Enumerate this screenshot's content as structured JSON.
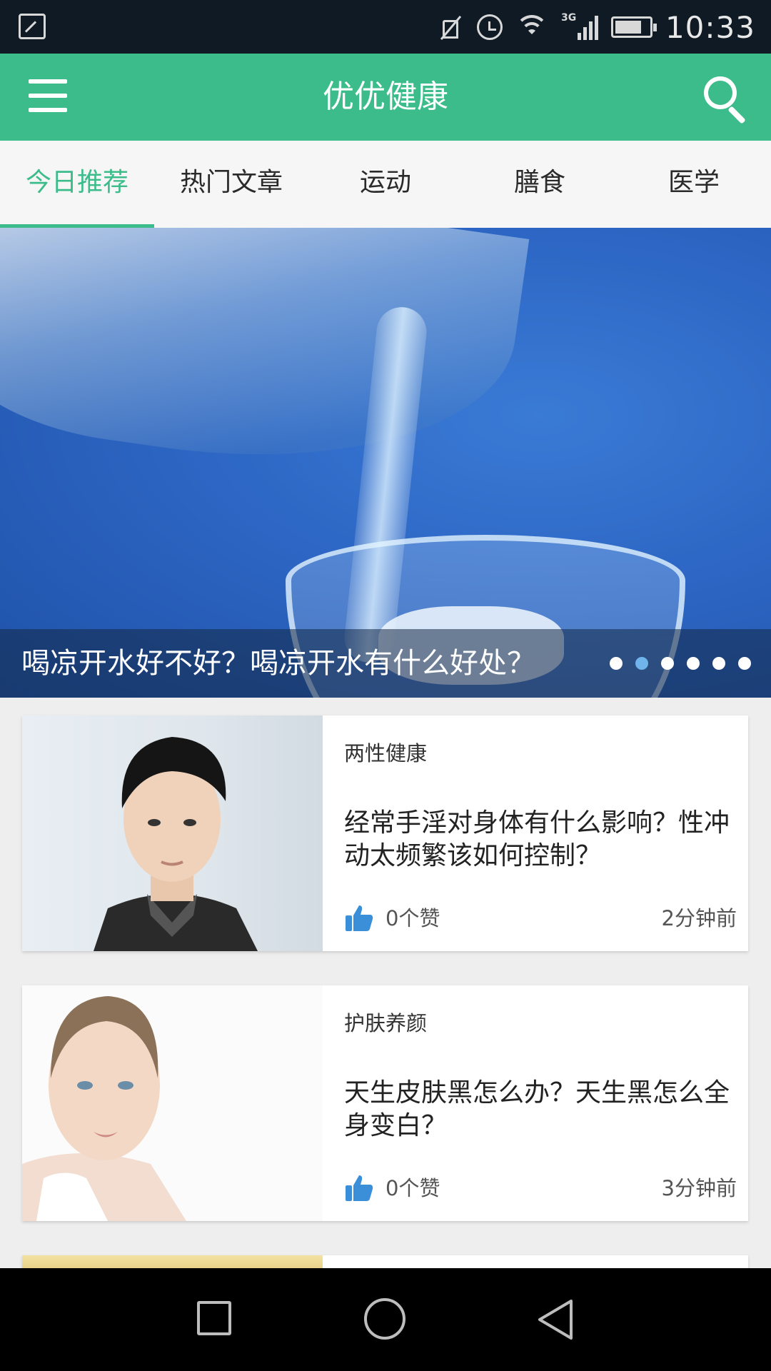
{
  "status_bar": {
    "time": "10:33",
    "network": "3G",
    "icons": [
      "gallery-icon",
      "mute-icon",
      "alarm-icon",
      "wifi-icon",
      "signal-icon",
      "battery-icon"
    ]
  },
  "app_bar": {
    "title": "优优健康",
    "menu_icon": "hamburger-menu-icon",
    "search_icon": "search-icon",
    "background_color": "#3cbc8a"
  },
  "tabs": [
    {
      "label": "今日推荐",
      "active": true
    },
    {
      "label": "热门文章",
      "active": false
    },
    {
      "label": "运动",
      "active": false
    },
    {
      "label": "膳食",
      "active": false
    },
    {
      "label": "医学",
      "active": false
    }
  ],
  "banner": {
    "caption": "喝凉开水好不好？喝凉开水有什么好处？",
    "slide_count": 6,
    "active_slide": 2
  },
  "articles": [
    {
      "category": "两性健康",
      "title": "经常手淫对身体有什么影响？性冲动太频繁该如何控制？",
      "likes": "0个赞",
      "time": "2分钟前"
    },
    {
      "category": "护肤养颜",
      "title": "天生皮肤黑怎么办？天生黑怎么全身变白？",
      "likes": "0个赞",
      "time": "3分钟前"
    }
  ],
  "nav_bar": {
    "buttons": [
      "recent-apps-icon",
      "home-icon",
      "back-icon"
    ]
  }
}
